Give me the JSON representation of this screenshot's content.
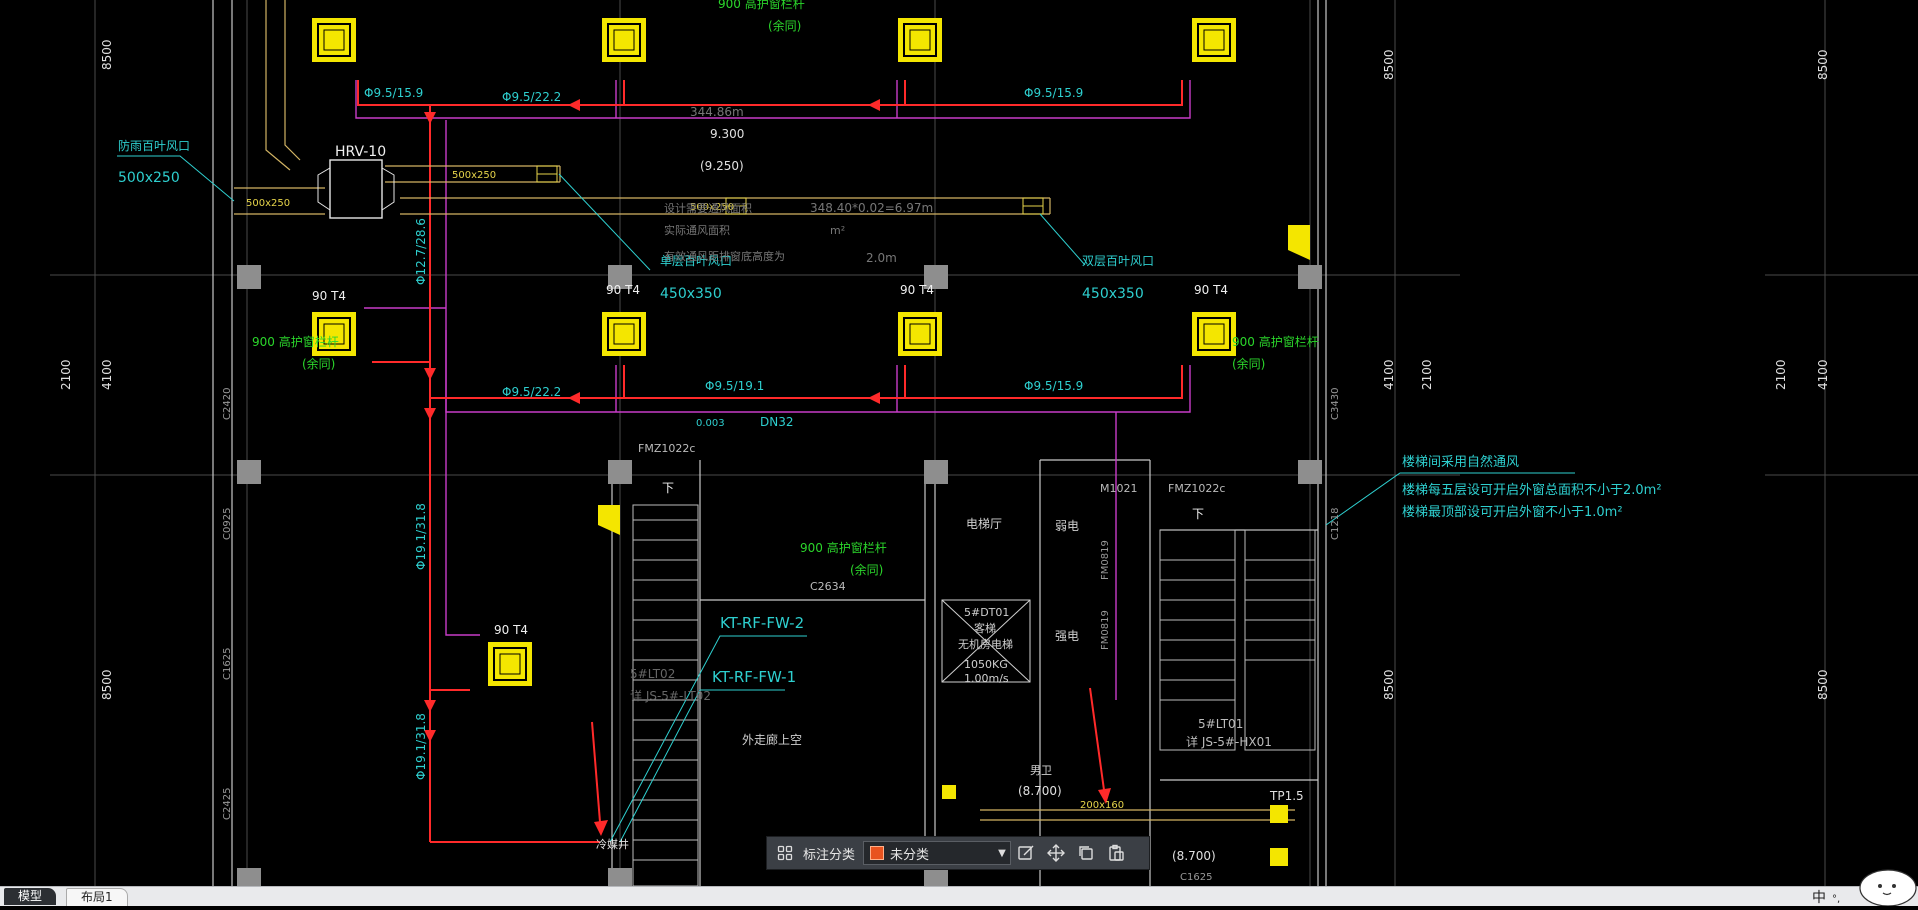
{
  "drawing": {
    "dims": {
      "d8500": "8500",
      "d4100": "4100",
      "d2100": "2100"
    },
    "equipment": {
      "hrv": "HRV-10"
    },
    "units": {
      "t4": "90 T4"
    },
    "pipes": {
      "p159": "Φ9.5/15.9",
      "p222": "Φ9.5/22.2",
      "p191": "Φ9.5/19.1",
      "p1272286": "Φ12.7/28.6",
      "p191318": "Φ19.1/31.8",
      "dn32": "DN32",
      "slope": "0.003"
    },
    "ducts": {
      "d500x250": "500x250",
      "d450x350": "450x350",
      "d200x160": "200x160"
    },
    "labels": {
      "louver_single": "防雨百叶风口",
      "louver_single2": "单层百叶风口",
      "louver_double": "双层百叶风口",
      "railing": "900  高护窗栏杆",
      "same": "(余同)",
      "length": "344.86m",
      "elev1": "9.300",
      "elev2": "(9.250)",
      "vent1": "设计需要通风面积",
      "vent_calc": "348.40*0.02=6.97m",
      "vent2": "实际通风面积",
      "m2": "m²",
      "vent3": "有效通风距排窗底高度为",
      "h20": "2.0m",
      "fm1": "FMZ1022c",
      "fm2": "FMZ1022c",
      "m1021": "M1021",
      "lift_hall": "电梯厅",
      "weak": "弱电",
      "strong": "强电",
      "c2634": "C2634",
      "kt2": "KT-RF-FW-2",
      "kt1": "KT-RF-FW-1",
      "lt02": "5#LT02",
      "js_lt02": "详  JS-5#-LT02",
      "lt01": "5#LT01",
      "js_hx01": "详  JS-5#-HX01",
      "outdoor": "外走廊上空",
      "elev_room": "5#DT01",
      "elev_guest": "客梯",
      "elev_nomr": "无机房电梯",
      "elev_load": "1050KG",
      "elev_speed": "1.00m/s",
      "tp15": "TP1.5",
      "elev3": "(8.700)",
      "elev4": "(8.700)",
      "shaft": "冷媒井",
      "wc": "男卫",
      "stair_note1": "楼梯间采用自然通风",
      "stair_note2": "楼梯每五层设可开启外窗总面积不小于2.0m²",
      "stair_note3": "楼梯最顶部设可开启外窗不小于1.0m²",
      "down": "下",
      "c3430": "C3430",
      "c1218": "C1218",
      "c2420": "C2420",
      "c0925": "C0925",
      "c1625": "C1625",
      "c2425": "C2425",
      "c1625b": "C1625",
      "fm0819a": "FM0819",
      "fm0819b": "FM0819"
    }
  },
  "toolbar": {
    "label": "标注分类",
    "selected": "未分类",
    "swatch_color": "#e8531f",
    "icons": [
      "grid-icon",
      "edit-icon",
      "move-icon",
      "copy-icon",
      "paste-icon"
    ]
  },
  "tabs": [
    {
      "label": "模型",
      "active": true
    },
    {
      "label": "布局1",
      "active": false
    }
  ],
  "ime": {
    "label": "中"
  }
}
